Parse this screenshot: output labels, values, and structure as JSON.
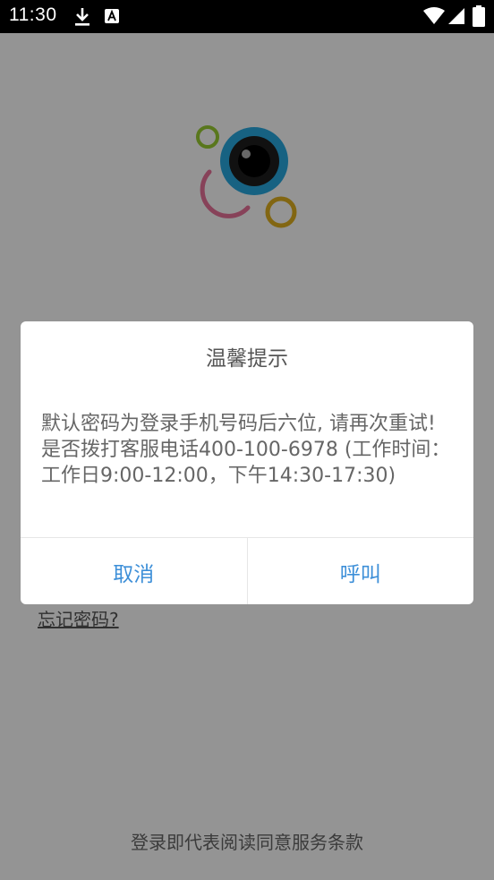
{
  "status_bar": {
    "time": "11:30",
    "icons": [
      "download-icon",
      "accessibility-icon",
      "wifi-icon",
      "signal-icon",
      "battery-icon"
    ]
  },
  "app": {
    "forgot_password_link": "忘记密码?",
    "terms_text": "登录即代表阅读同意服务条款",
    "logo_colors": {
      "green_ring": "#9acd32",
      "blue_lens": "#29a9e0",
      "pink_ring": "#e8739a",
      "yellow_ring": "#e0b020"
    }
  },
  "dialog": {
    "title": "温馨提示",
    "message": "默认密码为登录手机号码后六位, 请再次重试! 是否拨打客服电话400-100-6978 (工作时间：工作日9:00-12:00，下午14:30-17:30)",
    "cancel_label": "取消",
    "call_label": "呼叫"
  },
  "colors": {
    "accent": "#3d8fd8",
    "scrim": "rgba(0,0,0,0.42)",
    "status_bar_bg": "#000000"
  }
}
